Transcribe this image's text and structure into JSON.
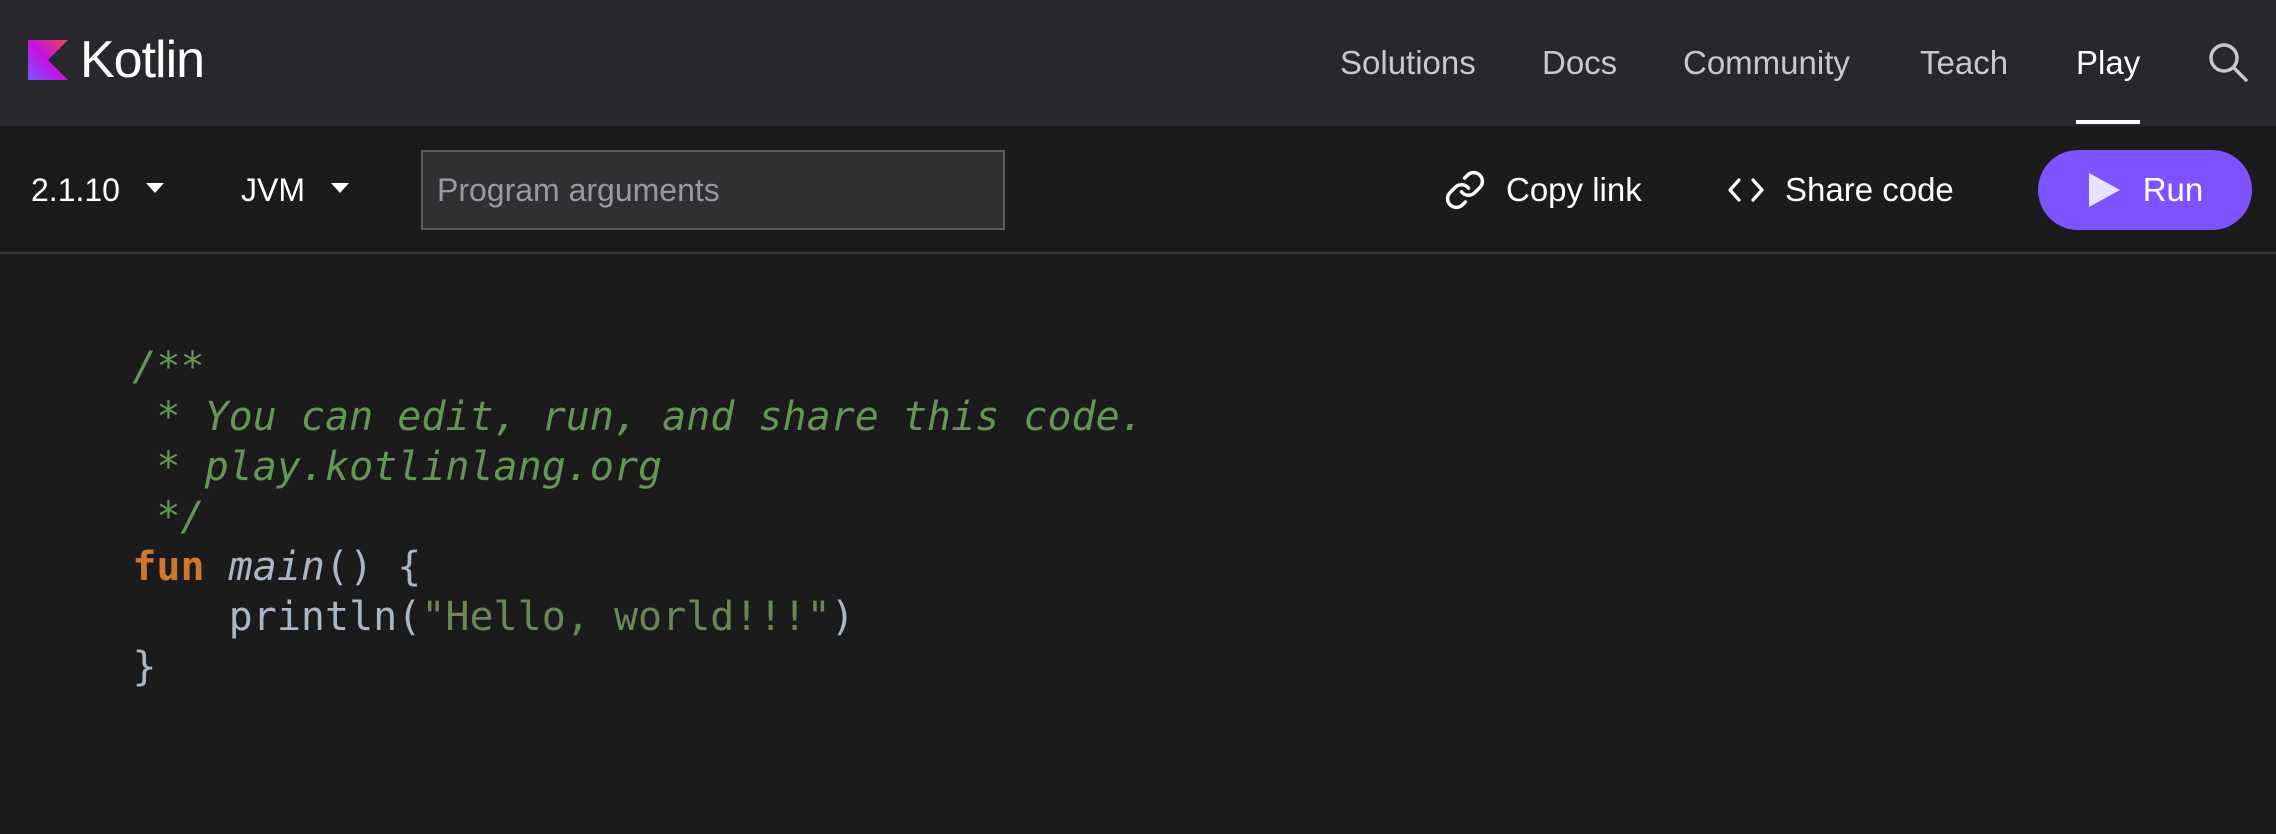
{
  "header": {
    "logo_text": "Kotlin",
    "nav": [
      {
        "label": "Solutions",
        "active": false
      },
      {
        "label": "Docs",
        "active": false
      },
      {
        "label": "Community",
        "active": false
      },
      {
        "label": "Teach",
        "active": false
      },
      {
        "label": "Play",
        "active": true
      }
    ],
    "search_icon": "search-icon"
  },
  "toolbar": {
    "version": "2.1.10",
    "target": "JVM",
    "args_placeholder": "Program arguments",
    "args_value": "",
    "copy_link_label": "Copy link",
    "copy_link_icon": "link-icon",
    "share_code_label": "Share code",
    "share_code_icon": "code-brackets-icon",
    "run_label": "Run",
    "run_icon": "play-icon"
  },
  "colors": {
    "nav_bg": "#27282c",
    "page_bg": "#1b1b1b",
    "accent": "#7f52ff",
    "comment": "#629755",
    "keyword": "#cc7832",
    "string": "#6a8759",
    "code_text": "#a9b7c6"
  },
  "editor": {
    "lines": [
      {
        "comment": "/**"
      },
      {
        "comment": " * You can edit, run, and share this code."
      },
      {
        "comment": " * play.kotlinlang.org"
      },
      {
        "comment": " */"
      },
      {
        "keyword": "fun",
        "space": " ",
        "fn": "main",
        "rest": "() {"
      },
      {
        "indent": "    ",
        "call": "println(",
        "string": "\"Hello, world!!!\"",
        "close": ")"
      },
      {
        "brace": "}"
      }
    ]
  }
}
